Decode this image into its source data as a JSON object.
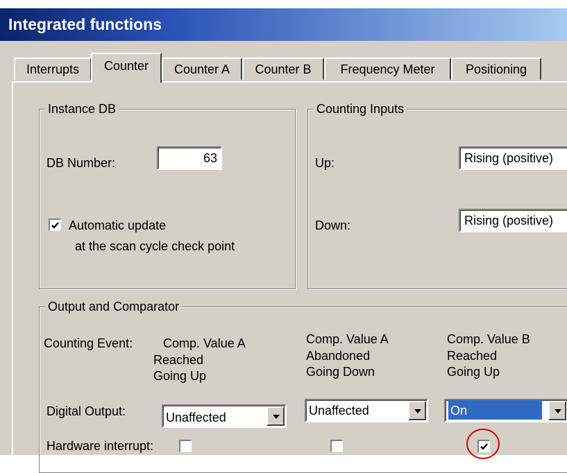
{
  "window": {
    "title": "Integrated functions"
  },
  "tabs": [
    {
      "label": "Interrupts"
    },
    {
      "label": "Counter"
    },
    {
      "label": "Counter A"
    },
    {
      "label": "Counter B"
    },
    {
      "label": "Frequency Meter"
    },
    {
      "label": "Positioning"
    }
  ],
  "active_tab": "Counter",
  "instance_db": {
    "legend": "Instance DB",
    "db_number_label": "DB Number:",
    "db_number_value": "63",
    "auto_update_checked": true,
    "auto_update_line1": "Automatic update",
    "auto_update_line2": "at the scan cycle check point"
  },
  "counting_inputs": {
    "legend": "Counting Inputs",
    "up_label": "Up:",
    "up_value": "Rising (positive)",
    "down_label": "Down:",
    "down_value": "Rising (positive)"
  },
  "output": {
    "legend": "Output and Comparator",
    "counting_event_label": "Counting Event:",
    "columns": [
      {
        "line1": "Comp. Value A",
        "line2": "Reached",
        "line3": "Going Up",
        "digital_output": "Unaffected",
        "hw_interrupt": false
      },
      {
        "line1": "Comp. Value A",
        "line2": "Abandoned",
        "line3": "Going Down",
        "digital_output": "Unaffected",
        "hw_interrupt": false
      },
      {
        "line1": "Comp. Value B",
        "line2": "Reached",
        "line3": "Going Up",
        "digital_output": "On",
        "hw_interrupt": true
      }
    ],
    "digital_output_label": "Digital Output:",
    "hw_interrupt_label": "Hardware interrupt:"
  },
  "colors": {
    "title_gradient_start": "#0a246a",
    "selection": "#316ac5",
    "highlight_ring": "#e00000"
  }
}
